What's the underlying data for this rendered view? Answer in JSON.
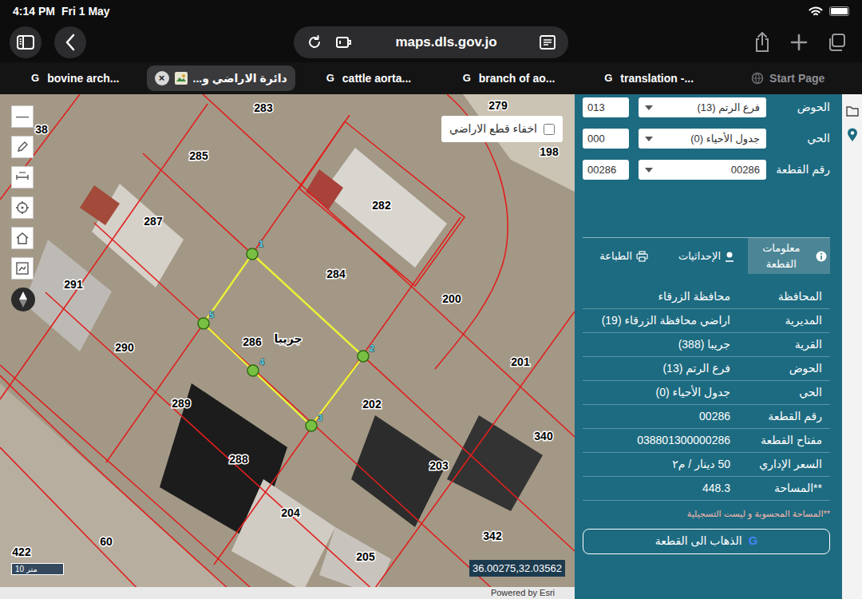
{
  "status_bar": {
    "time": "4:14 PM",
    "date": "Fri 1 May",
    "battery": {
      "level": 1
    }
  },
  "browser": {
    "url": "maps.dls.gov.jo"
  },
  "tabs": [
    {
      "label": "bovine arch...",
      "kind": "google",
      "favicon": "G",
      "selected": false
    },
    {
      "label": "دائرة الاراضي و...",
      "kind": "site",
      "close": "×",
      "selected": true
    },
    {
      "label": "cattle aorta...",
      "kind": "google",
      "favicon": "G",
      "selected": false
    },
    {
      "label": "branch of ao...",
      "kind": "google",
      "favicon": "G",
      "selected": false
    },
    {
      "label": "translation -...",
      "kind": "google",
      "favicon": "G",
      "selected": false
    },
    {
      "label": "Start Page",
      "kind": "start",
      "selected": false
    }
  ],
  "map": {
    "zoom_out": "—",
    "layer_toggle": {
      "label": "اخفاء قطع الاراضي",
      "checked": false
    },
    "parcels": [
      {
        "label": "38",
        "selected": false
      },
      {
        "label": "283",
        "selected": false
      },
      {
        "label": "279",
        "selected": false
      },
      {
        "label": "198",
        "selected": false
      },
      {
        "label": "285",
        "selected": false
      },
      {
        "label": "282",
        "selected": false
      },
      {
        "label": "287",
        "selected": false
      },
      {
        "label": "284",
        "selected": false
      },
      {
        "label": "291",
        "selected": false
      },
      {
        "label": "200",
        "selected": false
      },
      {
        "label": "290",
        "selected": false
      },
      {
        "label": "286",
        "selected": true
      },
      {
        "label": "201",
        "selected": false
      },
      {
        "label": "289",
        "selected": false
      },
      {
        "label": "202",
        "selected": false
      },
      {
        "label": "340",
        "selected": false
      },
      {
        "label": "288",
        "selected": false
      },
      {
        "label": "203",
        "selected": false
      },
      {
        "label": "204",
        "selected": false
      },
      {
        "label": "342",
        "selected": false
      },
      {
        "label": "60",
        "selected": false
      },
      {
        "label": "422",
        "selected": false
      },
      {
        "label": "205",
        "selected": false
      }
    ],
    "village": "جريبا",
    "vertices": [
      "1",
      "2",
      "3",
      "4",
      "5"
    ],
    "scale": "10 متر",
    "coordinates": "36.00275,32.03562",
    "attribution": "Powered by Esri"
  },
  "panel": {
    "fields": [
      {
        "label": "الحوض",
        "value": "فرع الرتم (13)",
        "code": "013"
      },
      {
        "label": "الحي",
        "value": "جدول الأحياء (0)",
        "code": "000"
      },
      {
        "label": "رقم القطعة",
        "value": "00286",
        "code": "00286"
      }
    ],
    "tabs": [
      {
        "label": "معلومات القطعة",
        "selected": true
      },
      {
        "label": "الإحداثيات",
        "selected": false
      },
      {
        "label": "الطباعة",
        "selected": false
      }
    ],
    "info": [
      {
        "label": "المحافظة",
        "value": "محافظة الزرقاء"
      },
      {
        "label": "المديرية",
        "value": "اراضي محافظة الزرقاء (19)"
      },
      {
        "label": "القرية",
        "value": "جريبا (388)"
      },
      {
        "label": "الحوض",
        "value": "فرع الرتم (13)"
      },
      {
        "label": "الحي",
        "value": "جدول الأحياء (0)"
      },
      {
        "label": "رقم القطعة",
        "value": "00286"
      },
      {
        "label": "مفتاح القطعة",
        "value": "038801300000286"
      },
      {
        "label": "السعر الإداري",
        "value": "50 دينار / م٢"
      },
      {
        "label": "**المساحة",
        "value": "448.3"
      }
    ],
    "note": "**المساحة المحسوبة و ليست التسجيلية",
    "go_button": {
      "label": "الذهاب الى القطعة",
      "icon": "G"
    }
  }
}
